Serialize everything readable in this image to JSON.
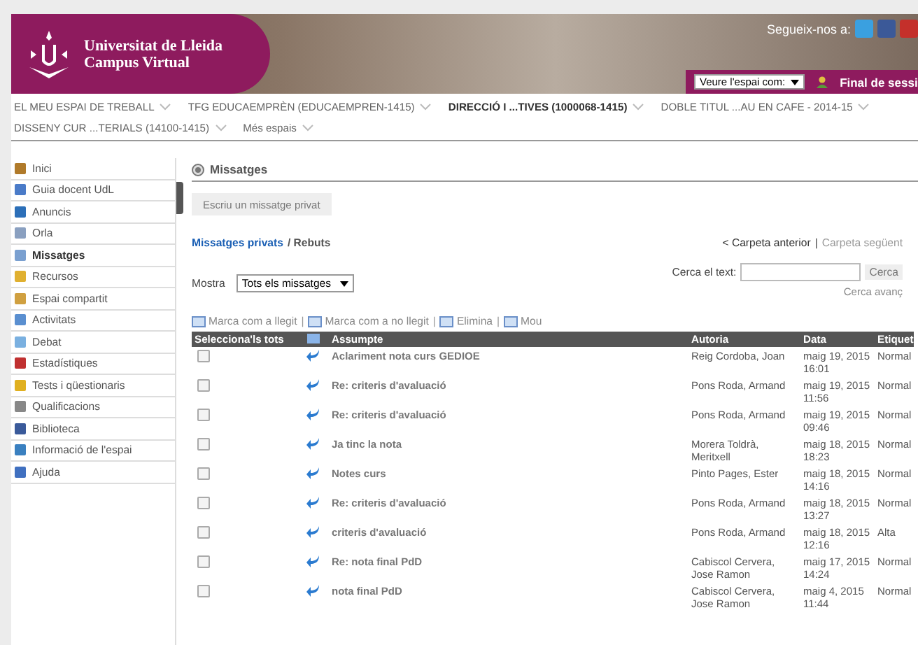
{
  "header": {
    "brand_line1": "Universitat de Lleida",
    "brand_line2": "Campus Virtual",
    "follow_label": "Segueix-nos a:",
    "view_as": "Veure l'espai com:",
    "logout": "Final de sessi"
  },
  "nav": [
    {
      "label": "EL MEU ESPAI DE TREBALL",
      "selected": false
    },
    {
      "label": "TFG EDUCAEMPRÈN (EDUCAEMPREN-1415)",
      "selected": false
    },
    {
      "label": "DIRECCIÓ I ...TIVES (1000068-1415)",
      "selected": true
    },
    {
      "label": "DOBLE TITUL ...AU EN CAFE - 2014-15",
      "selected": false
    },
    {
      "label": "DISSENY CUR ...TERIALS (14100-1415)",
      "selected": false
    },
    {
      "label": "Més espais",
      "selected": false
    }
  ],
  "sidebar": [
    {
      "label": "Inici",
      "selected": false
    },
    {
      "label": "Guia docent UdL",
      "selected": false
    },
    {
      "label": "Anuncis",
      "selected": false
    },
    {
      "label": "Orla",
      "selected": false
    },
    {
      "label": "Missatges",
      "selected": true
    },
    {
      "label": "Recursos",
      "selected": false
    },
    {
      "label": "Espai compartit",
      "selected": false
    },
    {
      "label": "Activitats",
      "selected": false
    },
    {
      "label": "Debat",
      "selected": false
    },
    {
      "label": "Estadístiques",
      "selected": false
    },
    {
      "label": "Tests i qüestionaris",
      "selected": false
    },
    {
      "label": "Qualificacions",
      "selected": false
    },
    {
      "label": "Biblioteca",
      "selected": false
    },
    {
      "label": "Informació de l'espai",
      "selected": false
    },
    {
      "label": "Ajuda",
      "selected": false
    }
  ],
  "page_title": "Missatges",
  "compose_button": "Escriu un missatge privat",
  "breadcrumb": {
    "link": "Missatges privats",
    "current": "/ Rebuts"
  },
  "folder_nav": {
    "previous": "< Carpeta anterior",
    "separator": "|",
    "next": "Carpeta següent"
  },
  "filter": {
    "label": "Mostra",
    "value": "Tots els missatges"
  },
  "search": {
    "label": "Cerca el text:",
    "button": "Cerca",
    "advanced": "Cerca avanç"
  },
  "actions": [
    "Marca com a llegit",
    "Marca com a no llegit",
    "Elimina",
    "Mou"
  ],
  "action_separator": "|",
  "table": {
    "columns": [
      "Selecciona'ls tots",
      "Assumpte",
      "Autoria",
      "Data",
      "Etiquet"
    ],
    "rows": [
      {
        "checked": false,
        "subject": "Aclariment nota curs GEDIOE",
        "author": "Reig Cordoba, Joan",
        "date": "maig 19, 2015",
        "time": "16:01",
        "label": "Normal"
      },
      {
        "checked": false,
        "subject": "Re: criteris d'avaluació",
        "author": "Pons Roda, Armand",
        "date": "maig 19, 2015",
        "time": "11:56",
        "label": "Normal"
      },
      {
        "checked": false,
        "subject": "Re: criteris d'avaluació",
        "author": "Pons Roda, Armand",
        "date": "maig 19, 2015",
        "time": "09:46",
        "label": "Normal"
      },
      {
        "checked": false,
        "subject": "Ja tinc la nota",
        "author": "Morera Toldrà, Meritxell",
        "date": "maig 18, 2015",
        "time": "18:23",
        "label": "Normal"
      },
      {
        "checked": false,
        "subject": "Notes curs",
        "author": "Pinto Pages, Ester",
        "date": "maig 18, 2015",
        "time": "14:16",
        "label": "Normal"
      },
      {
        "checked": false,
        "subject": "Re: criteris d'avaluació",
        "author": "Pons Roda, Armand",
        "date": "maig 18, 2015",
        "time": "13:27",
        "label": "Normal"
      },
      {
        "checked": false,
        "subject": "criteris d'avaluació",
        "author": "Pons Roda, Armand",
        "date": "maig 18, 2015",
        "time": "12:16",
        "label": "Alta"
      },
      {
        "checked": false,
        "subject": "Re: nota final PdD",
        "author": "Cabiscol Cervera, Jose Ramon",
        "date": "maig 17, 2015",
        "time": "14:24",
        "label": "Normal"
      },
      {
        "checked": false,
        "subject": "nota final PdD",
        "author": "Cabiscol Cervera, Jose Ramon",
        "date": "maig 4, 2015",
        "time": "11:44",
        "label": "Normal"
      }
    ]
  }
}
